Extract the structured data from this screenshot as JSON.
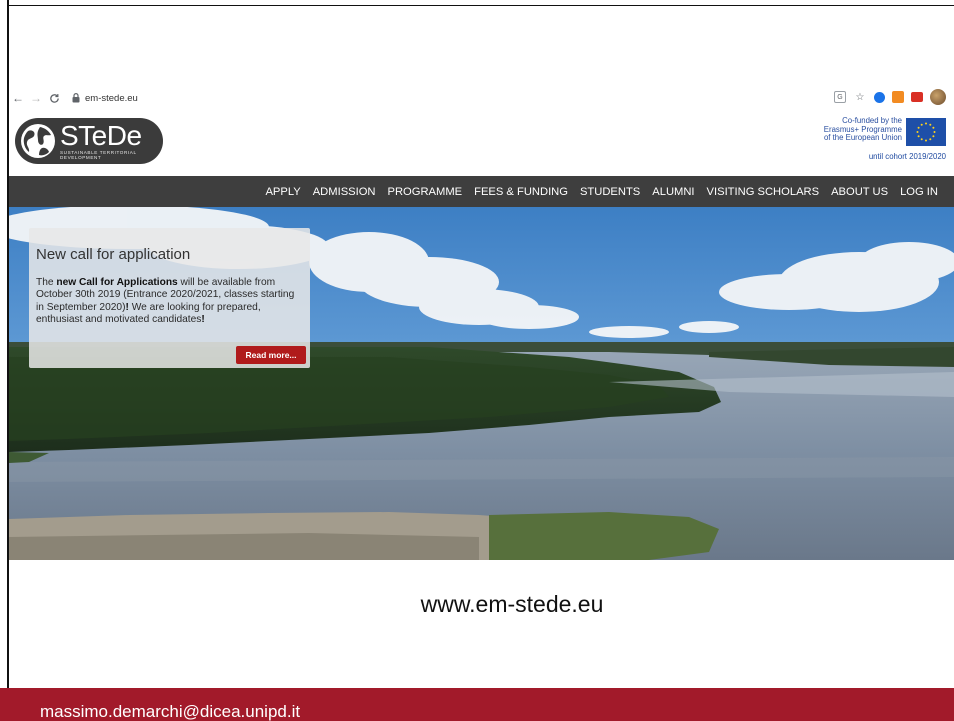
{
  "browser": {
    "back_icon": "arrow-left-icon",
    "forward_icon": "arrow-right-icon",
    "reload_icon": "reload-icon",
    "lock_icon": "lock-icon",
    "url": "em-stede.eu",
    "extensions": [
      "translate-icon",
      "star-icon",
      "extension-blue-icon",
      "extension-orange-icon",
      "extension-red-icon",
      "profile-avatar"
    ]
  },
  "header": {
    "logo": {
      "title": "STeDe",
      "subtitle_line1": "SUSTAINABLE TERRITORIAL",
      "subtitle_line2": "DEVELOPMENT"
    },
    "eu": {
      "line1": "Co-funded by the",
      "line2": "Erasmus+ Programme",
      "line3": "of the European Union",
      "until": "until cohort 2019/2020"
    }
  },
  "nav": {
    "items": [
      "APPLY",
      "ADMISSION",
      "PROGRAMME",
      "FEES & FUNDING",
      "STUDENTS",
      "ALUMNI",
      "VISITING SCHOLARS",
      "ABOUT US",
      "LOG IN"
    ]
  },
  "callout": {
    "title": "New call for application",
    "body_pre": "The ",
    "body_bold": "new Call for Applications",
    "body_mid": " will be available from October 30th 2019 (Entrance 2020/2021, classes starting in September 2020)",
    "body_bold2": "!",
    "body_post": " We are looking for prepared, enthusiast and motivated candidates",
    "body_bold3": "!",
    "read_more": "Read more..."
  },
  "caption": "www.em-stede.eu",
  "footer": {
    "email": "massimo.demarchi@dicea.unipd.it"
  },
  "colors": {
    "nav_bg": "#3e3e3e",
    "accent_red": "#b01b1b",
    "footer_bg": "#a21a2a",
    "eu_blue": "#1e4fa8"
  }
}
